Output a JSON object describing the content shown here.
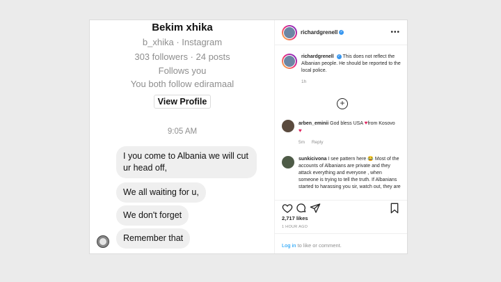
{
  "dm": {
    "profile_name": "Bekim xhika",
    "handle_line": "b_xhika · Instagram",
    "stats_line": "303 followers · 24 posts",
    "follows_line": "Follows you",
    "mutual_line": "You both follow ediramaal",
    "view_profile_label": "View Profile",
    "timestamp": "9:05 AM",
    "messages": [
      "I you come to Albania we will cut ur head off,",
      "We all waiting for u,",
      "We don't forget",
      "Remember that"
    ]
  },
  "post": {
    "username": "richardgrenell",
    "more_icon": "more-horizontal-icon",
    "caption": "This does not reflect the Albanian people. He should be reported to the local police.",
    "caption_time": "1h",
    "comments": [
      {
        "user": "arben_eminii",
        "text_before": "God bless USA",
        "text_after": "from Kosovo",
        "time": "5m",
        "reply": "Reply"
      },
      {
        "user": "sunkicivona",
        "text": "I see pattern here 😂 Most of the accounts of Albanians are private and they attack everything and everyone , when someone is trying to tell the truth. If Albanians started to harassing you sir, watch out, they are"
      }
    ],
    "likes": "2,717 likes",
    "posted_ago": "1 HOUR AGO",
    "login_link": "Log in",
    "login_suffix": "to like or comment."
  },
  "colors": {
    "link_blue": "#0095f6",
    "verified_blue": "#3897f0",
    "heart_red": "#e0245e",
    "bubble_gray": "#efefef"
  }
}
